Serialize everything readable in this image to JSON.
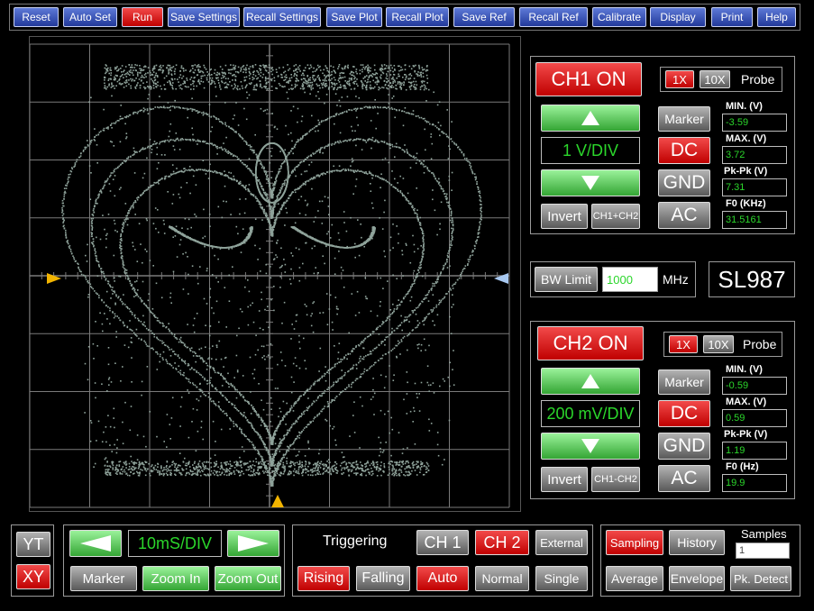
{
  "toolbar": [
    "Reset",
    "Auto Set",
    "Run",
    "Save Settings",
    "Recall Settings",
    "Save Plot",
    "Recall Plot",
    "Save Ref",
    "Recall Ref",
    "Calibrate",
    "Display",
    "Print",
    "Help"
  ],
  "ch1": {
    "on_label": "CH1 ON",
    "probe_1x": "1X",
    "probe_10x": "10X",
    "probe_label": "Probe",
    "vdiv": "1 V/DIV",
    "marker": "Marker",
    "dc": "DC",
    "gnd": "GND",
    "ac": "AC",
    "invert": "Invert",
    "math": "CH1+CH2",
    "min_label": "MIN. (V)",
    "min": "-3.59",
    "max_label": "MAX. (V)",
    "max": "3.72",
    "pkpk_label": "Pk-Pk (V)",
    "pkpk": "7.31",
    "f0_label": "F0 (KHz)",
    "f0": "31.5161"
  },
  "bw": {
    "button": "BW Limit",
    "value": "1000",
    "unit": "MHz"
  },
  "model": "SL987",
  "ch2": {
    "on_label": "CH2 ON",
    "probe_1x": "1X",
    "probe_10x": "10X",
    "probe_label": "Probe",
    "vdiv": "200 mV/DIV",
    "marker": "Marker",
    "dc": "DC",
    "gnd": "GND",
    "ac": "AC",
    "invert": "Invert",
    "math": "CH1-CH2",
    "min_label": "MIN. (V)",
    "min": "-0.59",
    "max_label": "MAX. (V)",
    "max": "0.59",
    "pkpk_label": "Pk-Pk (V)",
    "pkpk": "1.19",
    "f0_label": "F0 (Hz)",
    "f0": "19.9"
  },
  "mode": {
    "yt": "YT",
    "xy": "XY"
  },
  "timebase": {
    "value": "10mS/DIV",
    "marker": "Marker",
    "zoom_in": "Zoom In",
    "zoom_out": "Zoom Out"
  },
  "trigger": {
    "title": "Triggering",
    "ch1": "CH 1",
    "ch2": "CH 2",
    "external": "External",
    "rising": "Rising",
    "falling": "Falling",
    "auto": "Auto",
    "normal": "Normal",
    "single": "Single"
  },
  "acq": {
    "sampling": "Sampling",
    "history": "History",
    "samples_label": "Samples",
    "samples": "1",
    "average": "Average",
    "envelope": "Envelope",
    "pk_detect": "Pk. Detect"
  },
  "colors": {
    "trace": "#8fa39b",
    "grid": "#7a7a7a",
    "lcd_green": "#2bd62b",
    "toolbar_blue": "#3554c0",
    "active_red": "#d81515",
    "marker_orange": "#f2b400",
    "marker_blue": "#a8c8f0"
  }
}
